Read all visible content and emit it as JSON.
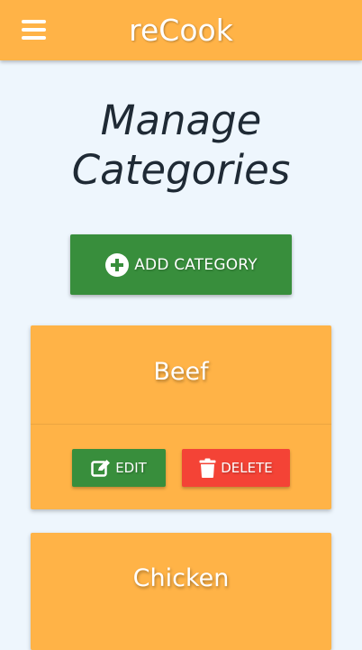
{
  "app": {
    "brand": "reCook",
    "menu_icon": "hamburger-menu-icon"
  },
  "page": {
    "title_line1": "Manage",
    "title_line2": "Categories"
  },
  "add_button": {
    "icon": "plus-circle-icon",
    "label": "ADD CATEGORY"
  },
  "categories": [
    {
      "name": "Beef",
      "edit_label": "EDIT",
      "edit_icon": "edit-icon",
      "delete_label": "DELETE",
      "delete_icon": "trash-icon"
    },
    {
      "name": "Chicken"
    }
  ],
  "colors": {
    "navbar": "#ffb347",
    "background": "#eef6fd",
    "primary_green": "#388e3c",
    "danger_red": "#f44336",
    "card": "#ffb347"
  }
}
